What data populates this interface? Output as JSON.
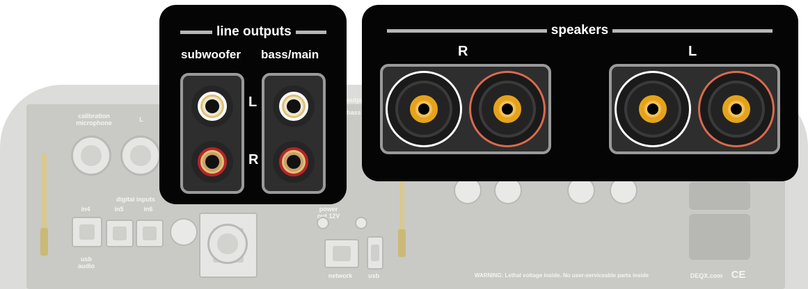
{
  "line_outputs": {
    "title": "line outputs",
    "columns": [
      "subwoofer",
      "bass/main"
    ],
    "channels": [
      "L",
      "R"
    ]
  },
  "speakers": {
    "title": "speakers",
    "channels": [
      "R",
      "L"
    ]
  },
  "background_device": {
    "labels": {
      "calibration": "calibration microphone",
      "xlr_l": "L",
      "outputs": "outputs",
      "bass": "bass",
      "digital_inputs": "digital inputs",
      "in4": "in4",
      "in5": "in5",
      "in6": "in6",
      "usb_audio": "usb audio",
      "power_out": "power out 12V",
      "network": "network",
      "usb": "usb",
      "warning": "WARNING: Lethal voltage inside. No user-serviceable parts inside",
      "brand": "DEQX.com",
      "ce_mark": "CE"
    }
  },
  "colors": {
    "panel": "#050505",
    "rca_red": "#b8232a",
    "rca_white": "#ffffff",
    "post_red_ring": "#d96a4c",
    "gold": "#e5a31c",
    "title_rule": "#b7b7b7"
  }
}
